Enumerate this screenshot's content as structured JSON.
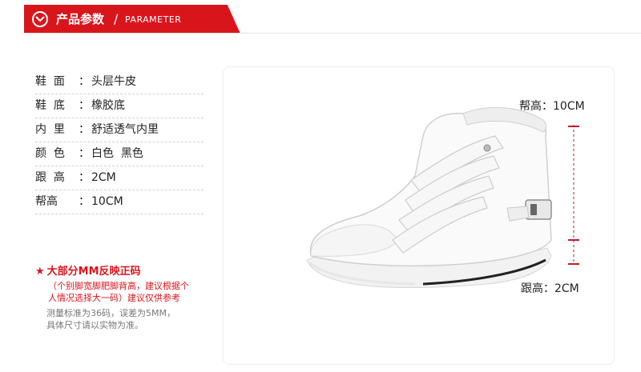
{
  "header": {
    "title": "产品参数",
    "slash": "/",
    "subtitle": "PARAMETER"
  },
  "specs": [
    {
      "label": "鞋  面",
      "value": "头层牛皮"
    },
    {
      "label": "鞋  底",
      "value": "橡胶底"
    },
    {
      "label": "内  里",
      "value": "舒适透气内里"
    },
    {
      "label": "颜  色",
      "value": "白色  黑色"
    },
    {
      "label": "跟  高",
      "value": "2CM"
    },
    {
      "label": "帮高",
      "value": "10CM"
    }
  ],
  "note": {
    "star": "★",
    "title": "大部分MM反映正码",
    "red_lines": [
      "（个别脚宽脚肥脚背高，建议根据个",
      "人情况选择大一码）建议仅供参考"
    ],
    "gray_lines": [
      "测量标准为36码，误差为5MM，",
      "具体尺寸请以实物为准。"
    ]
  },
  "measure": {
    "top_label": "帮高：10CM",
    "bottom_label": "跟高：2CM"
  },
  "colors": {
    "accent": "#d9151c",
    "bracket": "#c21a2a"
  }
}
